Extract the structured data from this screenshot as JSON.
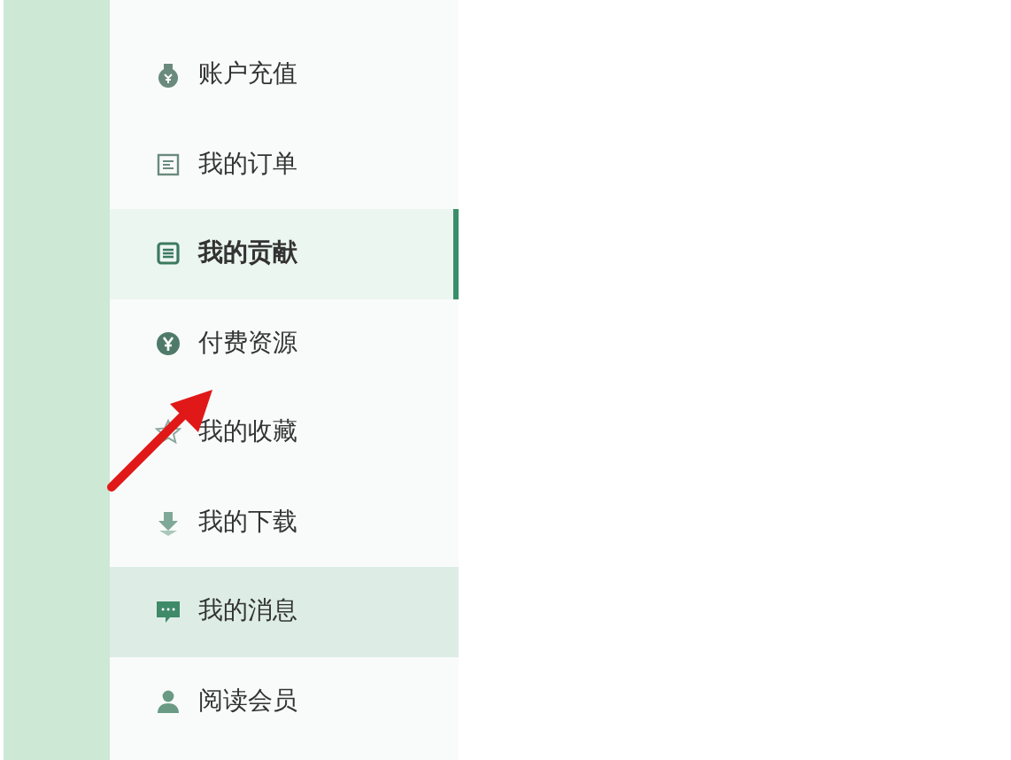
{
  "menu": {
    "items": [
      {
        "label": "账户充值",
        "selected": false,
        "hovered": false
      },
      {
        "label": "我的订单",
        "selected": false,
        "hovered": false
      },
      {
        "label": "我的贡献",
        "selected": true,
        "hovered": false
      },
      {
        "label": "付费资源",
        "selected": false,
        "hovered": false
      },
      {
        "label": "我的收藏",
        "selected": false,
        "hovered": false
      },
      {
        "label": "我的下载",
        "selected": false,
        "hovered": false
      },
      {
        "label": "我的消息",
        "selected": false,
        "hovered": true
      },
      {
        "label": "阅读会员",
        "selected": false,
        "hovered": false
      }
    ]
  }
}
